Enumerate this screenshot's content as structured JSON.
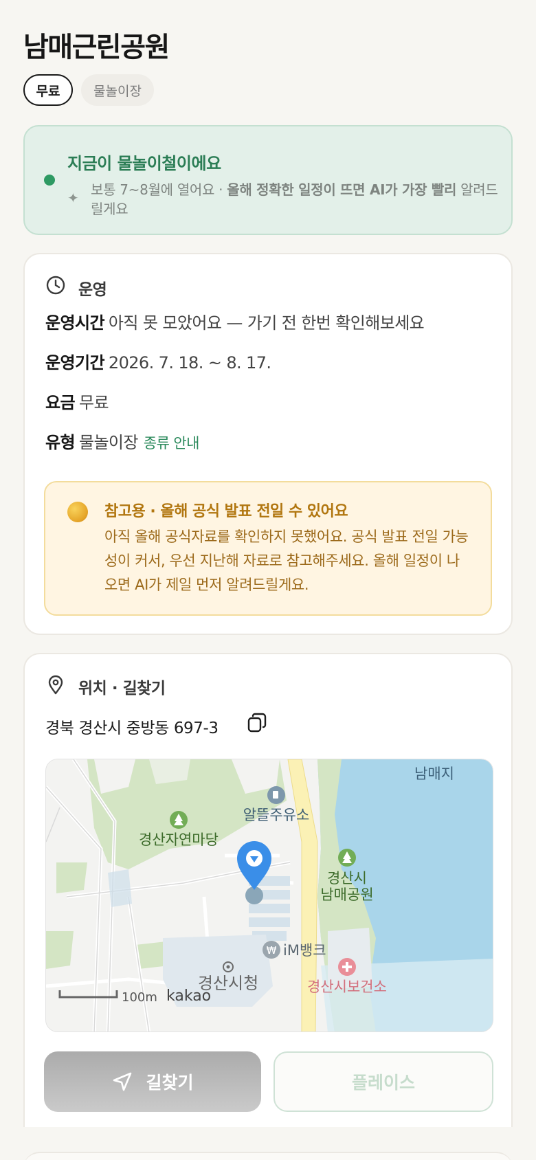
{
  "place": {
    "name": "남매근린공원",
    "tags": [
      "무료",
      "물놀이장"
    ]
  },
  "season_banner": {
    "headline": "지금이 물놀이철이에요",
    "body_plain": "보통 7~8월에 열어요 · ",
    "body_bold": "올해 정확한 일정이 뜨면 AI가 가장 빨리",
    "body_tail": "알려드릴게요",
    "accent_color": "#2e9a63"
  },
  "operation": {
    "section_title": "운영",
    "hours_label": "운영시간",
    "hours_value": "아직 못 모았어요 — 가기 전 한번 확인해보세요",
    "period_label": "운영기간",
    "period_value": "2026. 7. 18. ~ 8. 17.",
    "fee_label": "요금",
    "fee_value": "무료",
    "type_label": "유형",
    "type_value": "물놀이장",
    "type_link": "종류 안내",
    "notice": {
      "title": "참고용 · 올해 공식 발표 전일 수 있어요",
      "body": "아직 올해 공식자료를 확인하지 못했어요. 공식 발표 전일 가능성이 커서, 우선 지난해 자료로 참고해주세요. 올해 일정이 나오면 AI가 제일 먼저 알려드릴게요."
    }
  },
  "location": {
    "section_title": "위치 · 길찾기",
    "address": "경북 경산시 중방동 697-3",
    "map": {
      "labels": {
        "pond": "남매지",
        "gas_station": "알뜰주유소",
        "park_nature": "경산자연마당",
        "park_1": "경산시",
        "park_2": "남매공원",
        "bank": "iM뱅크",
        "city_hall": "경산시청",
        "health_center": "경산시보건소",
        "scale": "100m",
        "provider": "kakao"
      }
    },
    "route_button": "길찾기",
    "place_button": "플레이스"
  },
  "icons": [
    "clock-icon",
    "location-pin-icon",
    "copy-icon",
    "navigation-arrow-icon",
    "sparkle-icon",
    "moon-icon"
  ]
}
